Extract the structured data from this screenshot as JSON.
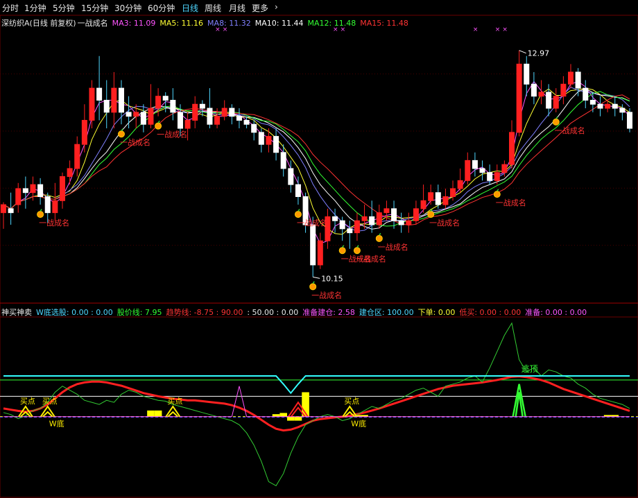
{
  "toolbar": {
    "tabs": [
      {
        "label": "分时",
        "active": false
      },
      {
        "label": "1分钟",
        "active": false
      },
      {
        "label": "5分钟",
        "active": false
      },
      {
        "label": "15分钟",
        "active": false
      },
      {
        "label": "30分钟",
        "active": false
      },
      {
        "label": "60分钟",
        "active": false
      },
      {
        "label": "日线",
        "active": true
      },
      {
        "label": "周线",
        "active": false
      },
      {
        "label": "月线",
        "active": false
      },
      {
        "label": "更多",
        "active": false
      }
    ],
    "more_arrow": "›"
  },
  "main_legend": {
    "title": "深纺织A(日线 前复权)",
    "indicator": "一战成名",
    "ma": [
      {
        "label": "MA3: 11.09",
        "color": "#ff55ff"
      },
      {
        "label": "MA5: 11.16",
        "color": "#ffff33"
      },
      {
        "label": "MA8: 11.32",
        "color": "#8080ff"
      },
      {
        "label": "MA10: 11.44",
        "color": "#ffffff"
      },
      {
        "label": "MA12: 11.48",
        "color": "#33ff33"
      },
      {
        "label": "MA15: 11.48",
        "color": "#ff3333"
      }
    ]
  },
  "sub_legend": {
    "items": [
      {
        "label": "神买神卖",
        "color": "#e8e8e8"
      },
      {
        "label": "W底选股: 0.00 : 0.00",
        "color": "#4fd7ff"
      },
      {
        "label": "股价线: 7.95",
        "color": "#33ff33"
      },
      {
        "label": "趋势线: -8.75 : 90.00",
        "color": "#ff3333"
      },
      {
        "label": ": 50.00 : 0.00",
        "color": "#e8e8e8"
      },
      {
        "label": "准备建仓: 2.58",
        "color": "#ff55ff"
      },
      {
        "label": "建仓区: 100.00",
        "color": "#4fd7ff"
      },
      {
        "label": "下单: 0.00",
        "color": "#ffff33"
      },
      {
        "label": "低买: 0.00 : 0.00",
        "color": "#ff3333"
      },
      {
        "label": "准备: 0.00 : 0.00",
        "color": "#ff55ff"
      }
    ]
  },
  "chart_data": [
    {
      "type": "candlestick",
      "stock": "深纺织A",
      "period": "日线",
      "adjustment": "前复权",
      "high_label": "12.97",
      "low_label": "10.15",
      "candles": [
        [
          10.95,
          11.05,
          10.75,
          11.08
        ],
        [
          11.0,
          10.95,
          10.8,
          11.2
        ],
        [
          11.05,
          11.25,
          10.95,
          11.32
        ],
        [
          11.25,
          11.2,
          11.0,
          11.4
        ],
        [
          11.2,
          11.3,
          11.1,
          11.4
        ],
        [
          11.3,
          11.15,
          11.05,
          11.38
        ],
        [
          11.15,
          10.95,
          10.82,
          11.2
        ],
        [
          10.95,
          11.1,
          10.85,
          11.32
        ],
        [
          11.1,
          11.4,
          11.0,
          11.45
        ],
        [
          11.4,
          11.5,
          11.3,
          11.6
        ],
        [
          11.5,
          11.8,
          11.4,
          11.9
        ],
        [
          11.8,
          12.1,
          11.7,
          12.3
        ],
        [
          12.1,
          12.5,
          12.0,
          12.6
        ],
        [
          12.5,
          12.35,
          12.1,
          12.9
        ],
        [
          12.35,
          12.2,
          12.0,
          12.6
        ],
        [
          12.2,
          12.5,
          12.0,
          12.7
        ],
        [
          12.5,
          12.2,
          12.05,
          12.6
        ],
        [
          12.2,
          12.15,
          12.0,
          12.4
        ],
        [
          12.15,
          12.2,
          12.0,
          12.3
        ],
        [
          12.2,
          12.05,
          11.95,
          12.3
        ],
        [
          12.05,
          12.25,
          12.0,
          12.55
        ],
        [
          12.25,
          12.4,
          12.15,
          12.5
        ],
        [
          12.4,
          12.35,
          12.2,
          12.45
        ],
        [
          12.35,
          12.2,
          12.1,
          12.5
        ],
        [
          12.2,
          12.0,
          11.9,
          12.3
        ],
        [
          12.0,
          12.1,
          11.85,
          12.2
        ],
        [
          12.1,
          12.3,
          12.0,
          12.4
        ],
        [
          12.3,
          12.25,
          12.15,
          12.35
        ],
        [
          12.25,
          12.05,
          12.0,
          12.5
        ],
        [
          12.05,
          12.15,
          12.0,
          12.25
        ],
        [
          12.15,
          12.25,
          12.1,
          12.35
        ],
        [
          12.25,
          12.15,
          12.05,
          12.3
        ],
        [
          12.15,
          12.1,
          12.0,
          12.25
        ],
        [
          12.1,
          12.05,
          12.0,
          12.15
        ],
        [
          12.05,
          11.95,
          11.85,
          12.1
        ],
        [
          11.95,
          11.8,
          11.7,
          12.0
        ],
        [
          11.8,
          11.9,
          11.7,
          12.0
        ],
        [
          11.9,
          11.7,
          11.6,
          12.0
        ],
        [
          11.7,
          11.5,
          11.4,
          11.8
        ],
        [
          11.5,
          11.3,
          11.2,
          11.6
        ],
        [
          11.3,
          11.15,
          11.05,
          11.4
        ],
        [
          11.15,
          10.8,
          10.7,
          11.2
        ],
        [
          10.8,
          10.3,
          10.15,
          10.9
        ],
        [
          10.3,
          10.6,
          10.25,
          10.7
        ],
        [
          10.6,
          10.9,
          10.5,
          11.0
        ],
        [
          10.9,
          10.85,
          10.7,
          11.0
        ],
        [
          10.85,
          10.75,
          10.6,
          10.9
        ],
        [
          10.75,
          10.7,
          10.5,
          10.85
        ],
        [
          10.7,
          10.85,
          10.6,
          10.95
        ],
        [
          10.85,
          10.9,
          10.75,
          11.05
        ],
        [
          10.9,
          10.8,
          10.7,
          11.1
        ],
        [
          10.8,
          10.95,
          10.75,
          11.05
        ],
        [
          10.95,
          11.0,
          10.85,
          11.1
        ],
        [
          11.0,
          10.85,
          10.75,
          11.1
        ],
        [
          10.85,
          10.8,
          10.7,
          10.95
        ],
        [
          10.8,
          10.85,
          10.7,
          10.95
        ],
        [
          10.85,
          11.0,
          10.8,
          11.1
        ],
        [
          11.0,
          11.1,
          10.95,
          11.3
        ],
        [
          11.1,
          11.2,
          11.05,
          11.3
        ],
        [
          11.2,
          11.05,
          11.0,
          11.3
        ],
        [
          11.05,
          11.15,
          11.0,
          11.25
        ],
        [
          11.15,
          11.25,
          11.1,
          11.35
        ],
        [
          11.25,
          11.35,
          11.2,
          11.5
        ],
        [
          11.35,
          11.6,
          11.3,
          11.7
        ],
        [
          11.6,
          11.5,
          11.4,
          11.7
        ],
        [
          11.5,
          11.45,
          11.35,
          11.6
        ],
        [
          11.45,
          11.35,
          11.3,
          11.55
        ],
        [
          11.35,
          11.45,
          11.3,
          11.55
        ],
        [
          11.45,
          11.55,
          11.4,
          11.6
        ],
        [
          11.55,
          11.95,
          11.5,
          12.1
        ],
        [
          11.95,
          12.8,
          11.9,
          12.97
        ],
        [
          12.8,
          12.55,
          12.4,
          12.9
        ],
        [
          12.55,
          12.4,
          12.3,
          12.7
        ],
        [
          12.4,
          12.45,
          12.3,
          12.6
        ],
        [
          12.45,
          12.25,
          12.15,
          12.55
        ],
        [
          12.25,
          12.4,
          12.2,
          12.5
        ],
        [
          12.4,
          12.55,
          12.3,
          12.65
        ],
        [
          12.55,
          12.7,
          12.5,
          12.8
        ],
        [
          12.7,
          12.5,
          12.4,
          12.75
        ],
        [
          12.5,
          12.35,
          12.25,
          12.6
        ],
        [
          12.35,
          12.3,
          12.2,
          12.45
        ],
        [
          12.3,
          12.25,
          12.15,
          12.4
        ],
        [
          12.25,
          12.3,
          12.2,
          12.35
        ],
        [
          12.3,
          12.25,
          12.15,
          12.4
        ],
        [
          12.25,
          12.2,
          12.1,
          12.3
        ],
        [
          12.2,
          12.0,
          11.95,
          12.25
        ]
      ],
      "signal_label": "一战成名",
      "signals": [
        5,
        16,
        21,
        40,
        42,
        46,
        48,
        51,
        58,
        67,
        75
      ],
      "marks": [
        29,
        30,
        45,
        46,
        64,
        67,
        68
      ]
    },
    {
      "type": "line",
      "name": "神买神卖",
      "series": [
        {
          "name": "趋势线",
          "color": "#ff2020",
          "values": [
            20,
            17,
            14,
            12,
            14,
            20,
            30,
            45,
            60,
            72,
            80,
            84,
            86,
            86,
            84,
            80,
            76,
            70,
            64,
            58,
            54,
            50,
            47,
            44,
            42,
            40,
            40,
            38,
            36,
            34,
            32,
            28,
            22,
            14,
            4,
            -8,
            -20,
            -30,
            -34,
            -32,
            -26,
            -18,
            -10,
            -6,
            -4,
            -2,
            0,
            2,
            6,
            10,
            15,
            20,
            26,
            32,
            38,
            44,
            50,
            56,
            62,
            68,
            72,
            76,
            78,
            80,
            82,
            84,
            87,
            90,
            94,
            98,
            99,
            97,
            94,
            90,
            84,
            76,
            68,
            62,
            56,
            50,
            44,
            38,
            32,
            26,
            20,
            14
          ]
        },
        {
          "name": "股价线",
          "color": "#33cc33",
          "values": [
            10,
            5,
            -5,
            2,
            15,
            20,
            35,
            60,
            75,
            65,
            55,
            40,
            35,
            30,
            40,
            35,
            55,
            65,
            60,
            50,
            45,
            40,
            38,
            30,
            25,
            20,
            15,
            10,
            5,
            0,
            -5,
            -10,
            -20,
            -40,
            -70,
            -110,
            -160,
            -170,
            -140,
            -90,
            -50,
            -20,
            -10,
            0,
            5,
            0,
            -10,
            -5,
            5,
            15,
            25,
            20,
            30,
            40,
            45,
            55,
            65,
            70,
            60,
            50,
            75,
            80,
            85,
            95,
            100,
            85,
            120,
            160,
            200,
            230,
            140,
            110,
            120,
            100,
            115,
            110,
            100,
            95,
            80,
            70,
            55,
            45,
            40,
            35,
            30,
            20
          ]
        },
        {
          "name": "准备建仓",
          "color": "#ff55ff",
          "values": [
            0,
            0,
            0,
            0,
            0,
            0,
            0,
            0,
            0,
            0,
            0,
            0,
            0,
            0,
            0,
            0,
            0,
            0,
            0,
            0,
            0,
            0,
            0,
            0,
            0,
            0,
            0,
            0,
            0,
            0,
            0,
            0,
            75,
            0,
            0,
            0,
            0,
            0,
            0,
            0,
            0,
            0,
            0,
            0,
            0,
            0,
            0,
            0,
            0,
            0,
            0,
            0,
            0,
            0,
            0,
            0,
            0,
            0,
            0,
            0,
            0,
            0,
            0,
            0,
            0,
            0,
            0,
            0,
            0,
            0,
            0,
            0,
            0,
            0,
            0,
            0,
            0,
            0,
            0,
            0,
            0,
            0,
            0,
            0,
            0,
            0
          ]
        },
        {
          "name": "W底选股",
          "color": "#33ffff",
          "values": [
            100,
            100,
            100,
            100,
            100,
            100,
            100,
            100,
            100,
            100,
            100,
            100,
            100,
            100,
            100,
            100,
            100,
            100,
            100,
            100,
            100,
            100,
            100,
            100,
            100,
            100,
            100,
            100,
            100,
            100,
            100,
            100,
            100,
            100,
            100,
            100,
            100,
            100,
            100,
            100,
            100,
            100,
            100,
            100,
            100,
            100,
            100,
            100,
            100,
            100,
            100,
            100,
            100,
            100,
            100,
            100,
            100,
            100,
            100,
            100,
            100,
            100,
            100,
            100,
            100,
            100,
            100,
            100,
            100,
            100,
            100,
            100,
            100,
            100,
            100,
            100,
            100,
            100,
            100,
            100,
            100,
            100,
            100,
            100,
            100,
            100
          ]
        }
      ],
      "w_dip_at": [
        38,
        39,
        40
      ],
      "levels": [
        90,
        50,
        0
      ],
      "top_label": "逃顶",
      "buy_label": "买点",
      "bottom_label": "W底",
      "buy_points": [
        3,
        6,
        23,
        47
      ],
      "w_bottoms": [
        6,
        47
      ],
      "yellow_bars": [
        [
          20,
          15
        ],
        [
          21,
          15
        ],
        [
          37,
          6
        ],
        [
          38,
          9
        ],
        [
          39,
          -10
        ],
        [
          40,
          -10
        ],
        [
          41,
          60
        ],
        [
          48,
          4
        ],
        [
          49,
          4
        ],
        [
          82,
          4
        ],
        [
          83,
          4
        ]
      ],
      "red_spike": 40,
      "green_spike": 70
    }
  ]
}
